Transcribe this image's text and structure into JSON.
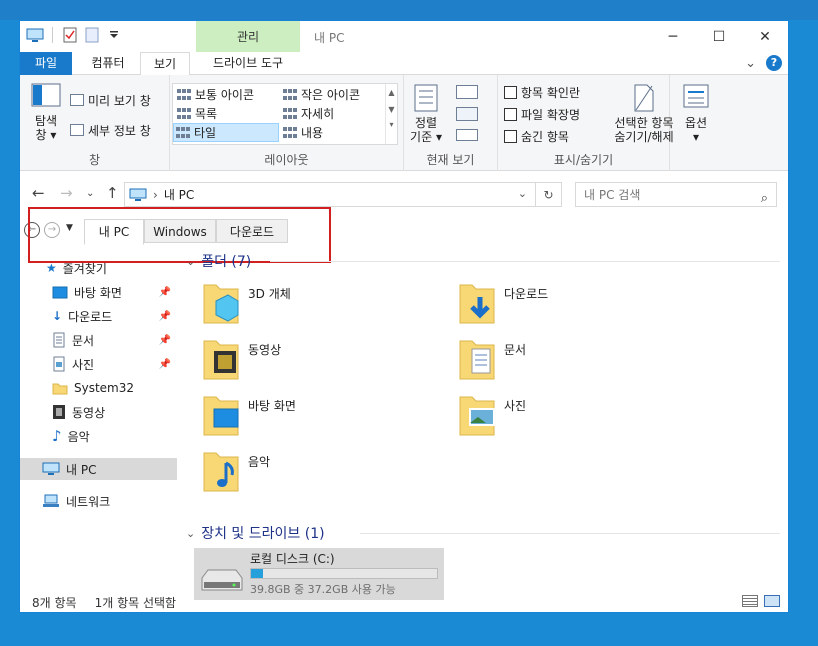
{
  "titlebar": {
    "manage_label": "관리",
    "window_title": "내 PC",
    "minimize": "─",
    "maximize": "☐",
    "close": "✕"
  },
  "ribbon_tabs": {
    "file": "파일",
    "computer": "컴퓨터",
    "view": "보기",
    "drive_tools": "드라이브 도구",
    "expand": "⌄",
    "help": "?"
  },
  "ribbon": {
    "pane_group": {
      "nav_pane_label_1": "탐색",
      "nav_pane_label_2": "창",
      "preview_pane": "미리 보기 창",
      "details_pane": "세부 정보 창",
      "group_label": "창"
    },
    "layout_group": {
      "items": [
        "보통 아이콘",
        "작은 아이콘",
        "목록",
        "자세히",
        "타일",
        "내용"
      ],
      "selected": "타일",
      "group_label": "레이아웃"
    },
    "view_group": {
      "sort_label_1": "정렬",
      "sort_label_2": "기준",
      "group_label": "현재 보기"
    },
    "show_group": {
      "item_checkboxes": "항목 확인란",
      "file_extensions": "파일 확장명",
      "hidden_items": "숨긴 항목",
      "hide_selected_1": "선택한 항목",
      "hide_selected_2": "숨기기/해제",
      "group_label": "표시/숨기기"
    },
    "options_group": {
      "label": "옵션"
    }
  },
  "addressbar": {
    "path": "내 PC",
    "search_placeholder": "내 PC 검색"
  },
  "folder_tabs": {
    "tabs": [
      "내 PC",
      "Windows",
      "다운로드"
    ],
    "active": "내 PC"
  },
  "navpane": {
    "favorites": "즐겨찾기",
    "items": [
      "바탕 화면",
      "다운로드",
      "문서",
      "사진",
      "System32",
      "동영상",
      "음악"
    ],
    "this_pc": "내 PC",
    "network": "네트워크"
  },
  "content": {
    "folders_header": "폴더 (7)",
    "folders": [
      "3D 개체",
      "다운로드",
      "동영상",
      "문서",
      "바탕 화면",
      "사진",
      "음악"
    ],
    "devices_header": "장치 및 드라이브 (1)",
    "drive": {
      "name": "로컬 디스크 (C:)",
      "space": "39.8GB 중 37.2GB 사용 가능",
      "used_fraction": 0.065
    }
  },
  "statusbar": {
    "item_count": "8개 항목",
    "selected_count": "1개 항목 선택함"
  },
  "colors": {
    "accent": "#1979ca",
    "manage_tab": "#cdeec0",
    "highlight_box": "#d22020",
    "header_text": "#1e3287"
  }
}
